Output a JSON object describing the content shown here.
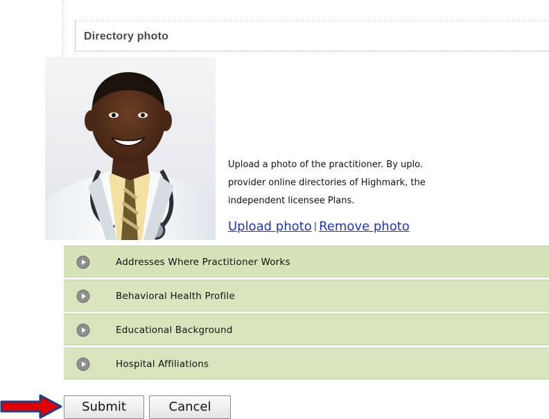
{
  "section": {
    "title": "Directory photo"
  },
  "photo": {
    "description_line1": "Upload a photo of the practitioner. By uplo.",
    "description_line2": "provider online directories of Highmark, the",
    "description_line3": "independent licensee Plans.",
    "upload_label": "Upload photo",
    "separator": "|",
    "remove_label": "Remove photo"
  },
  "accordion": {
    "items": [
      {
        "label": "Addresses Where Practitioner Works",
        "icon": "play-circle-icon"
      },
      {
        "label": "Behavioral Health Profile",
        "icon": "play-circle-icon"
      },
      {
        "label": "Educational Background",
        "icon": "play-circle-icon"
      },
      {
        "label": "Hospital Affiliations",
        "icon": "play-circle-icon"
      }
    ]
  },
  "actions": {
    "submit_label": "Submit",
    "cancel_label": "Cancel",
    "pointer_icon": "red-arrow-icon"
  },
  "colors": {
    "accordion_bg": "#d8e4bc",
    "link": "#1a35c8",
    "arrow_fill": "#e00000",
    "arrow_stroke": "#1f3e8a"
  }
}
